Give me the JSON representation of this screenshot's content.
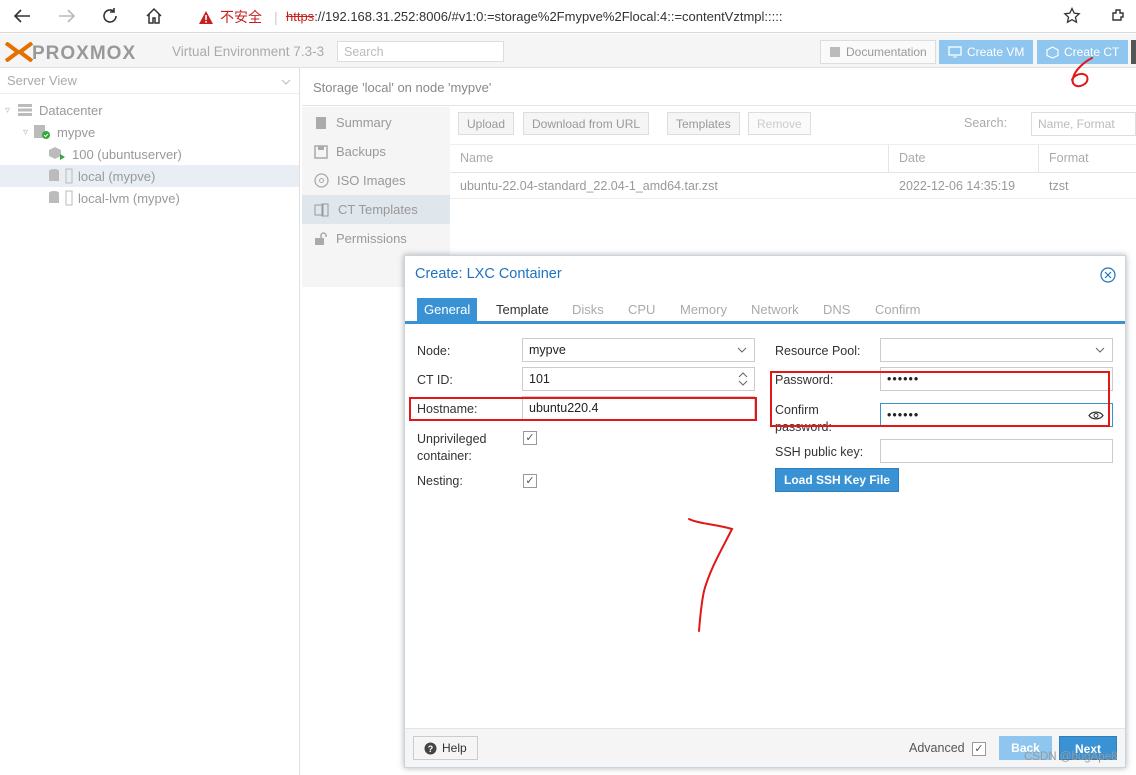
{
  "browser": {
    "security_label": "不安全",
    "url_protocol": "https",
    "url_rest": "://192.168.31.252:8006/#v1:0:=storage%2Fmypve%2Flocal:4::=contentVztmpl:::::"
  },
  "header": {
    "logo": "PROXMOX",
    "version": "Virtual Environment 7.3-3",
    "search_placeholder": "Search",
    "documentation": "Documentation",
    "create_vm": "Create VM",
    "create_ct": "Create CT"
  },
  "tree": {
    "view": "Server View",
    "items": [
      {
        "label": "Datacenter"
      },
      {
        "label": "mypve"
      },
      {
        "label": "100 (ubuntuserver)"
      },
      {
        "label": "local (mypve)"
      },
      {
        "label": "local-lvm (mypve)"
      }
    ]
  },
  "content": {
    "breadcrumb": "Storage 'local' on node 'mypve'",
    "nav": [
      "Summary",
      "Backups",
      "ISO Images",
      "CT Templates",
      "Permissions"
    ],
    "toolbar": {
      "upload": "Upload",
      "download": "Download from URL",
      "templates": "Templates",
      "remove": "Remove",
      "search_label": "Search:",
      "search_placeholder": "Name, Format"
    },
    "columns": [
      "Name",
      "Date",
      "Format"
    ],
    "rows": [
      {
        "name": "ubuntu-22.04-standard_22.04-1_amd64.tar.zst",
        "date": "2022-12-06 14:35:19",
        "format": "tzst"
      }
    ]
  },
  "dialog": {
    "title": "Create: LXC Container",
    "tabs": [
      "General",
      "Template",
      "Disks",
      "CPU",
      "Memory",
      "Network",
      "DNS",
      "Confirm"
    ],
    "fields": {
      "node_label": "Node:",
      "node_value": "mypve",
      "ctid_label": "CT ID:",
      "ctid_value": "101",
      "hostname_label": "Hostname:",
      "hostname_value": "ubuntu220.4",
      "unpriv_label_1": "Unprivileged",
      "unpriv_label_2": "container:",
      "nesting_label": "Nesting:",
      "pool_label": "Resource Pool:",
      "password_label": "Password:",
      "password_value": "••••••",
      "confirm_label_1": "Confirm",
      "confirm_label_2": "password:",
      "confirm_value": "••••••",
      "ssh_label": "SSH public key:",
      "load_ssh": "Load SSH Key File"
    },
    "footer": {
      "help": "Help",
      "advanced": "Advanced",
      "back": "Back",
      "next": "Next"
    }
  },
  "annotations": {
    "step_six": "6",
    "step_seven": "7"
  },
  "watermark": "CSDN @bugApe8",
  "colors": {
    "accent": "#3892d4",
    "annotation_red": "#e01818",
    "header_blue_disabled": "#8ec6ef"
  }
}
